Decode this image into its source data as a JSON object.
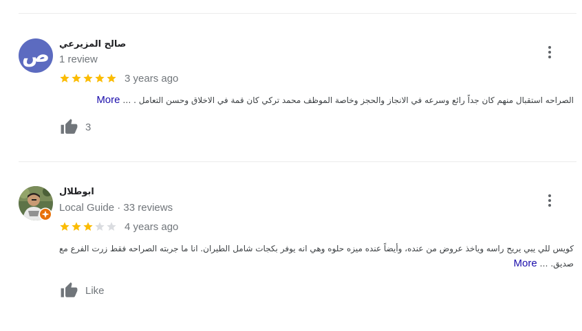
{
  "reviews": [
    {
      "avatar_letter": "ص",
      "avatar_color": "#5c6bc0",
      "name": "صالح المزيرعي",
      "meta": "1 review",
      "rating": 5,
      "date": "3 years ago",
      "text": "الصراحه استقبال منهم كان جداً رائع وسرعه في الانجاز والحجز  وخاصة الموظف محمد تركي كان قمة في الاخلاق وحسن التعامل . …",
      "more_label": "More",
      "like_label": "3"
    },
    {
      "avatar_letter": "",
      "avatar_color": "#556b45",
      "name": "ابوطلال",
      "meta": "Local Guide · 33 reviews",
      "rating": 3,
      "date": "4 years ago",
      "text": "كويس للي يبي يريح راسه وياخذ عروض من عنده، وأيضاً عنده ميزه حلوه وهي انه يوفر بكجات شامل الطيران. انا ما جربته الصراحه فقط زرت الفرع مع صديق. …",
      "more_label": "More",
      "like_label": "Like"
    }
  ],
  "colors": {
    "star_filled": "#fbbc04",
    "star_empty": "#dadce0",
    "link": "#1a0dab",
    "meta": "#70757a",
    "guide_badge": "#e8710a"
  },
  "icons": [
    "star-icon",
    "thumbs-up-icon",
    "more-vert-icon",
    "local-guide-badge-icon"
  ]
}
